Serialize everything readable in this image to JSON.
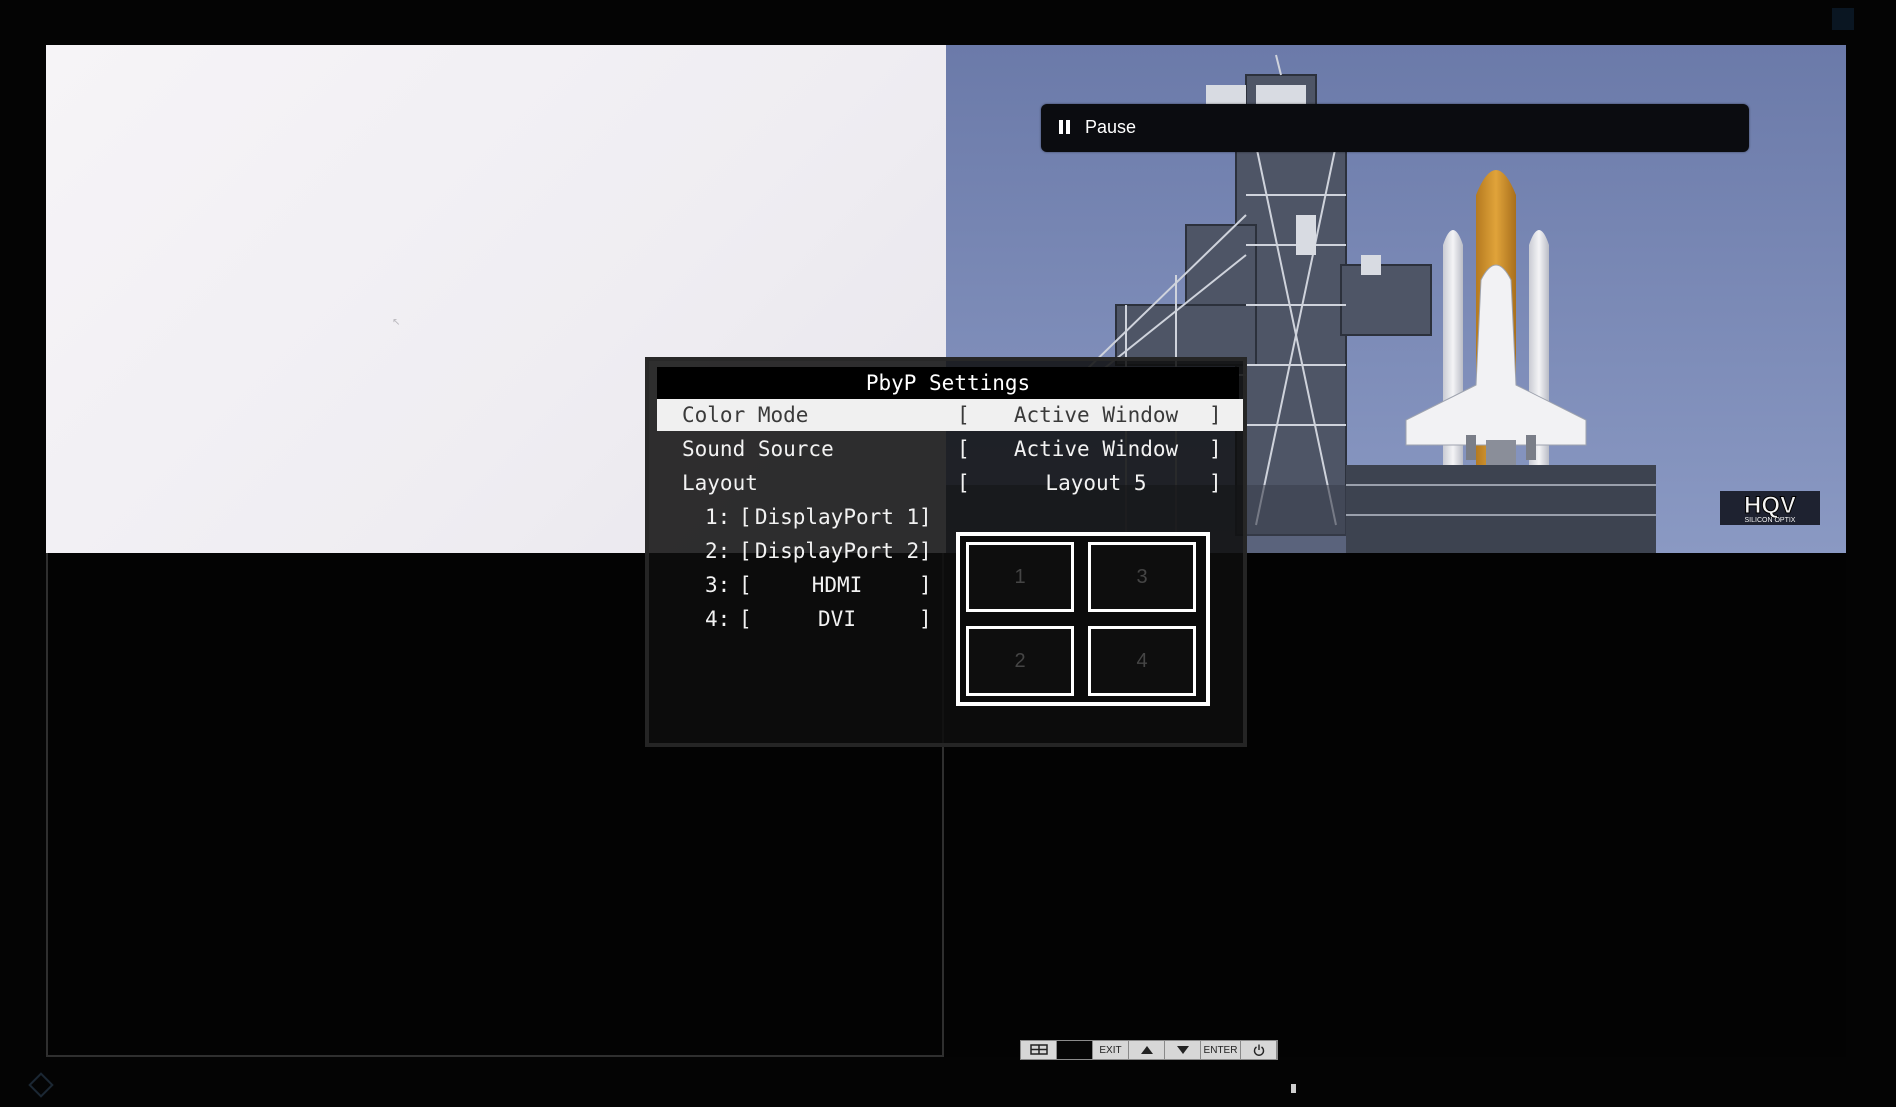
{
  "player": {
    "pause_label": "Pause"
  },
  "video": {
    "logo_text": "HQV",
    "logo_subtext": "SILICON OPTIX"
  },
  "osd": {
    "title": "PbyP Settings",
    "rows": [
      {
        "label": "Color Mode",
        "value": "Active Window",
        "bracket_open": "[",
        "bracket_close": "]"
      },
      {
        "label": "Sound Source",
        "value": "Active Window",
        "bracket_open": "[",
        "bracket_close": "]"
      },
      {
        "label": "Layout",
        "value": "Layout 5",
        "bracket_open": "[",
        "bracket_close": "]"
      }
    ],
    "sources": [
      {
        "num": "1:",
        "name": "DisplayPort 1"
      },
      {
        "num": "2:",
        "name": "DisplayPort 2"
      },
      {
        "num": "3:",
        "name": "HDMI"
      },
      {
        "num": "4:",
        "name": "DVI"
      }
    ],
    "layout_cells": [
      "1",
      "3",
      "2",
      "4"
    ]
  },
  "buttons": {
    "exit": "EXIT",
    "enter": "ENTER"
  },
  "colors": {
    "osd_selected_bg": "#f0f0f0",
    "pause_bar_bg": "#0b0c10",
    "sky": "#7c8dba"
  },
  "icons": [
    "pause-icon",
    "input-icon",
    "up-arrow-icon",
    "down-arrow-icon",
    "power-icon",
    "cursor-icon"
  ]
}
